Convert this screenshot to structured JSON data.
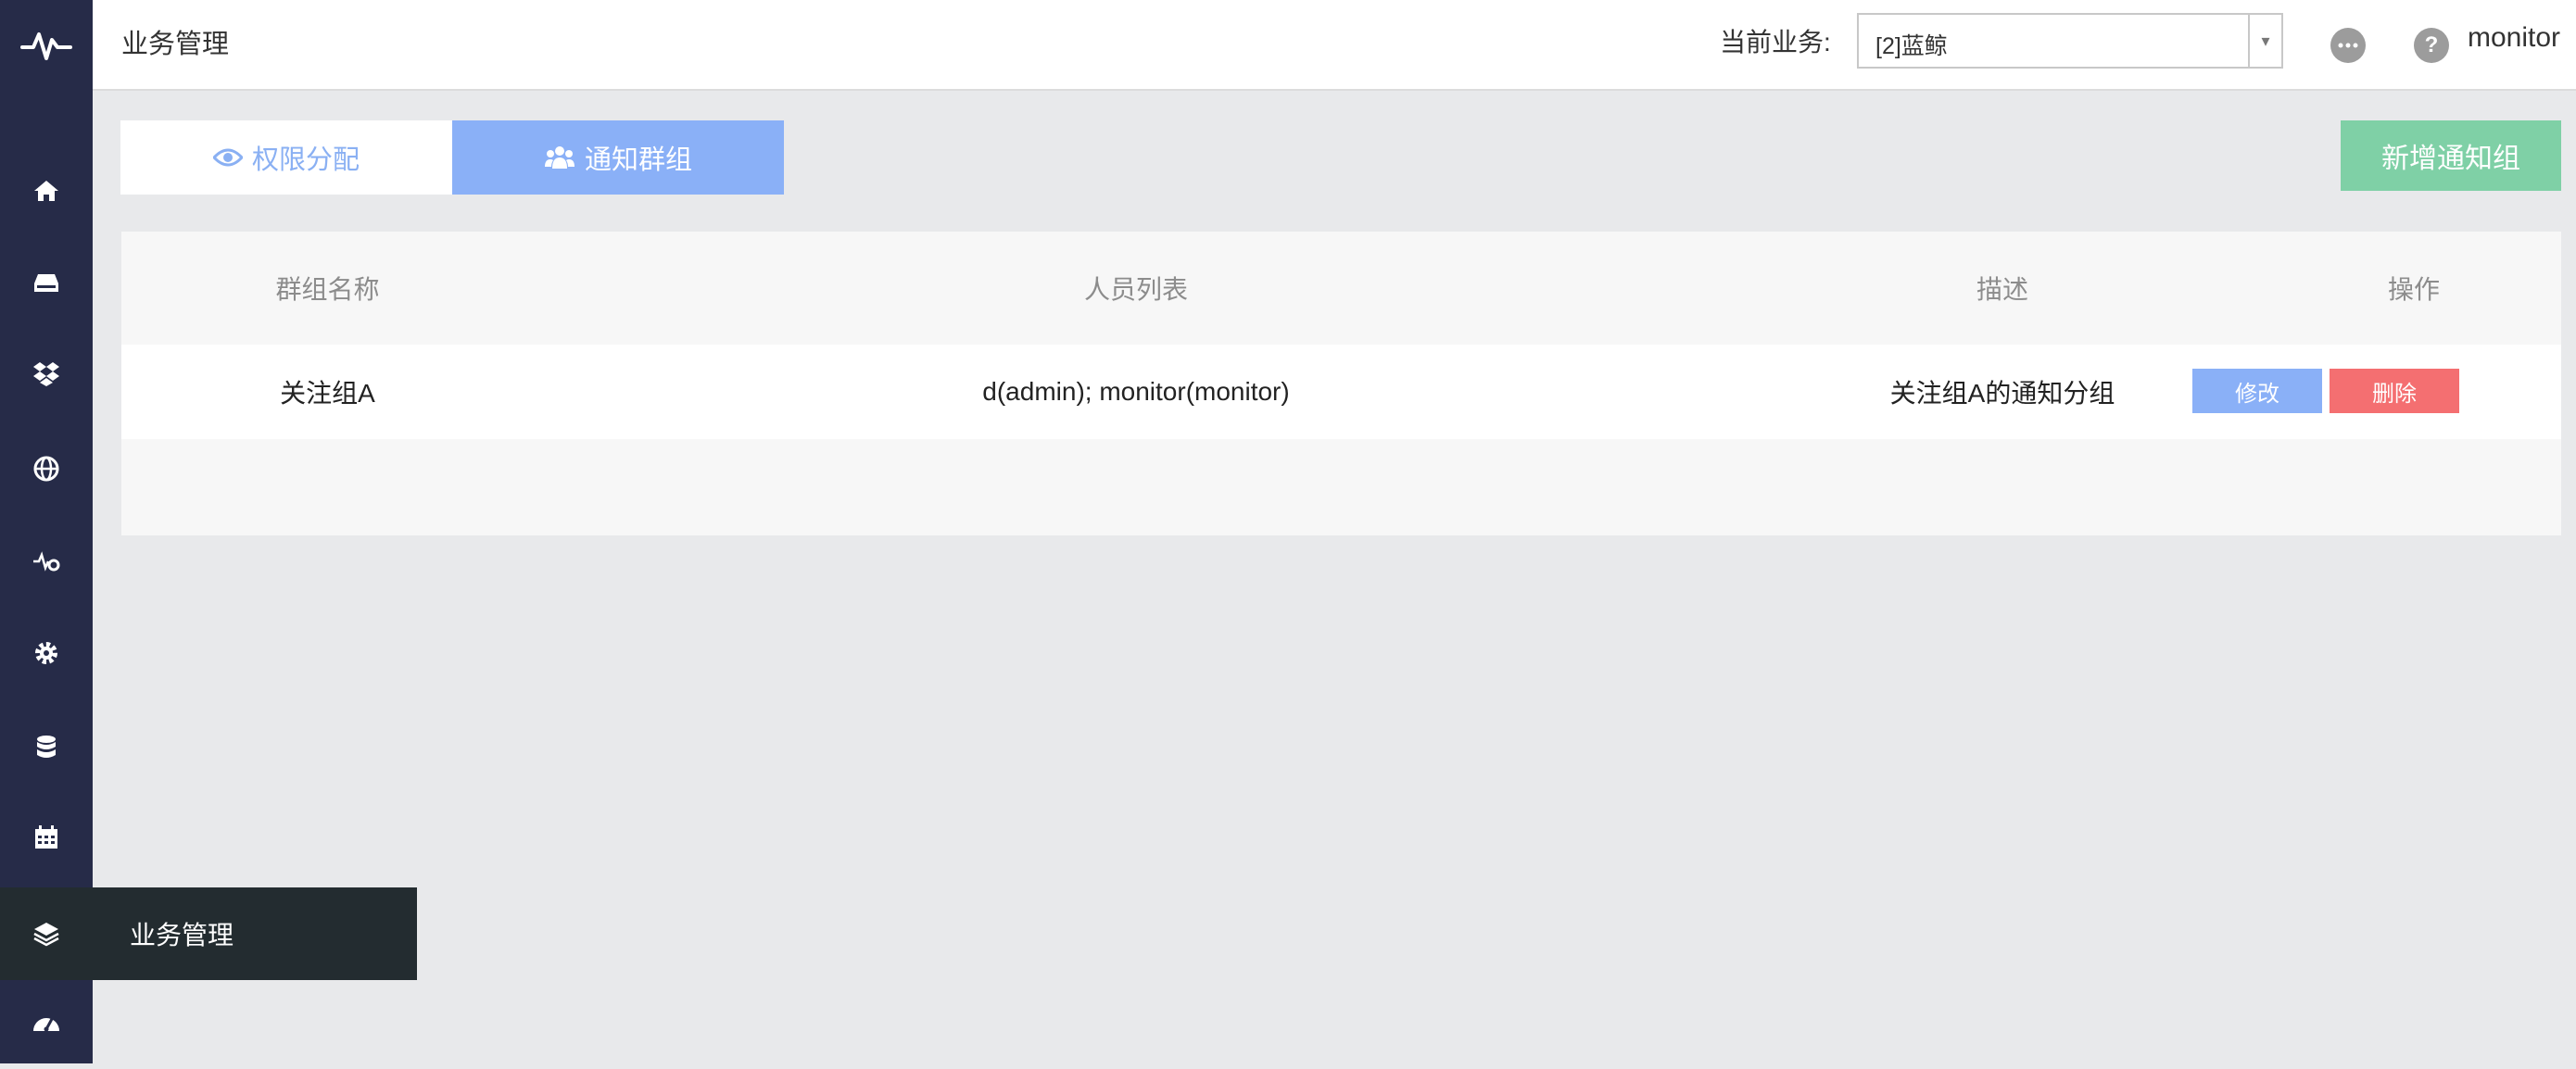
{
  "header": {
    "page_title": "业务管理",
    "biz_label": "当前业务:",
    "biz_selected": "[2]蓝鲸",
    "more_icon": "more-icon",
    "help_icon": "help-icon",
    "help_glyph": "?",
    "user": "monitor"
  },
  "sidebar": {
    "items": [
      {
        "icon": "home-icon"
      },
      {
        "icon": "inbox-icon"
      },
      {
        "icon": "dropbox-icon"
      },
      {
        "icon": "globe-icon"
      },
      {
        "icon": "pulse-gear-icon"
      },
      {
        "icon": "gear-icon"
      },
      {
        "icon": "database-icon"
      },
      {
        "icon": "calendar-icon"
      },
      {
        "icon": "layers-icon"
      },
      {
        "icon": "dashboard-icon"
      }
    ],
    "active_tooltip": "业务管理"
  },
  "tabs": [
    {
      "label": "权限分配",
      "icon": "eye-icon"
    },
    {
      "label": "通知群组",
      "icon": "users-icon"
    }
  ],
  "add_button": "新增通知组",
  "table": {
    "headers": [
      "群组名称",
      "人员列表",
      "描述",
      "操作"
    ],
    "rows": [
      {
        "name": "关注组A",
        "members": "d(admin); monitor(monitor)",
        "desc": "关注组A的通知分组",
        "edit": "修改",
        "delete": "删除"
      }
    ]
  },
  "colors": {
    "sidebar": "#262b48",
    "primary": "#8ab0f7",
    "success": "#7fd0a6",
    "danger": "#f46f71"
  }
}
